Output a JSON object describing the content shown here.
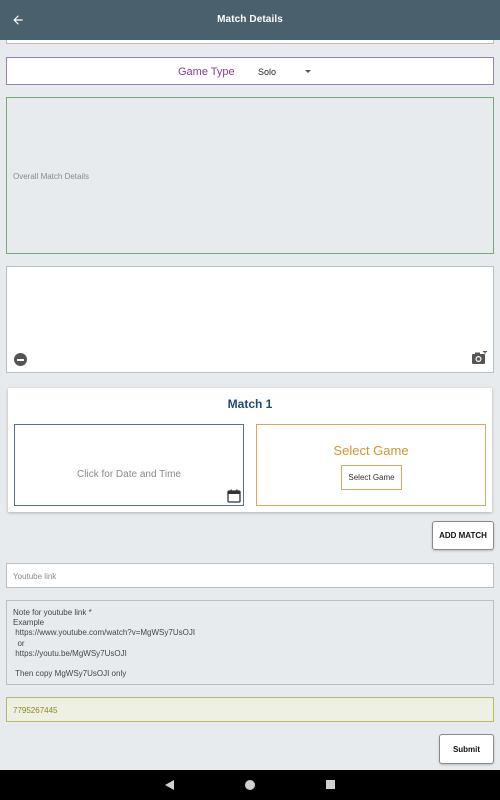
{
  "header": {
    "title": "Match Details"
  },
  "game_type": {
    "label": "Game Type",
    "selected": "Solo"
  },
  "overall": {
    "label": "Overall Match Details"
  },
  "match": {
    "title": "Match 1",
    "date_placeholder": "Click for Date and Time",
    "select_game_title": "Select Game",
    "select_game_button": "Select Game"
  },
  "add_match_label": "ADD MATCH",
  "youtube": {
    "placeholder": "Youtube link"
  },
  "note": {
    "lines": [
      "Note for youtube link *",
      "Example",
      " https://www.youtube.com/watch?v=MgWSy7UsOJI",
      "  or",
      " https://youtu.be/MgWSy7UsOJI",
      "",
      " Then copy MgWSy7UsOJI only"
    ]
  },
  "phone": {
    "value": "7795267445"
  },
  "submit_label": "Submit",
  "icons": {
    "back": "arrow-left-icon",
    "dropdown": "caret-down-icon",
    "remove": "minus-circle-icon",
    "camera": "camera-plus-icon",
    "calendar": "calendar-icon"
  },
  "colors": {
    "appbar": "#4a606c",
    "game_type_label": "#8a3a9a",
    "match_title": "#1d4a7a",
    "select_game": "#d49430",
    "phone_text": "#8a8a1a"
  }
}
